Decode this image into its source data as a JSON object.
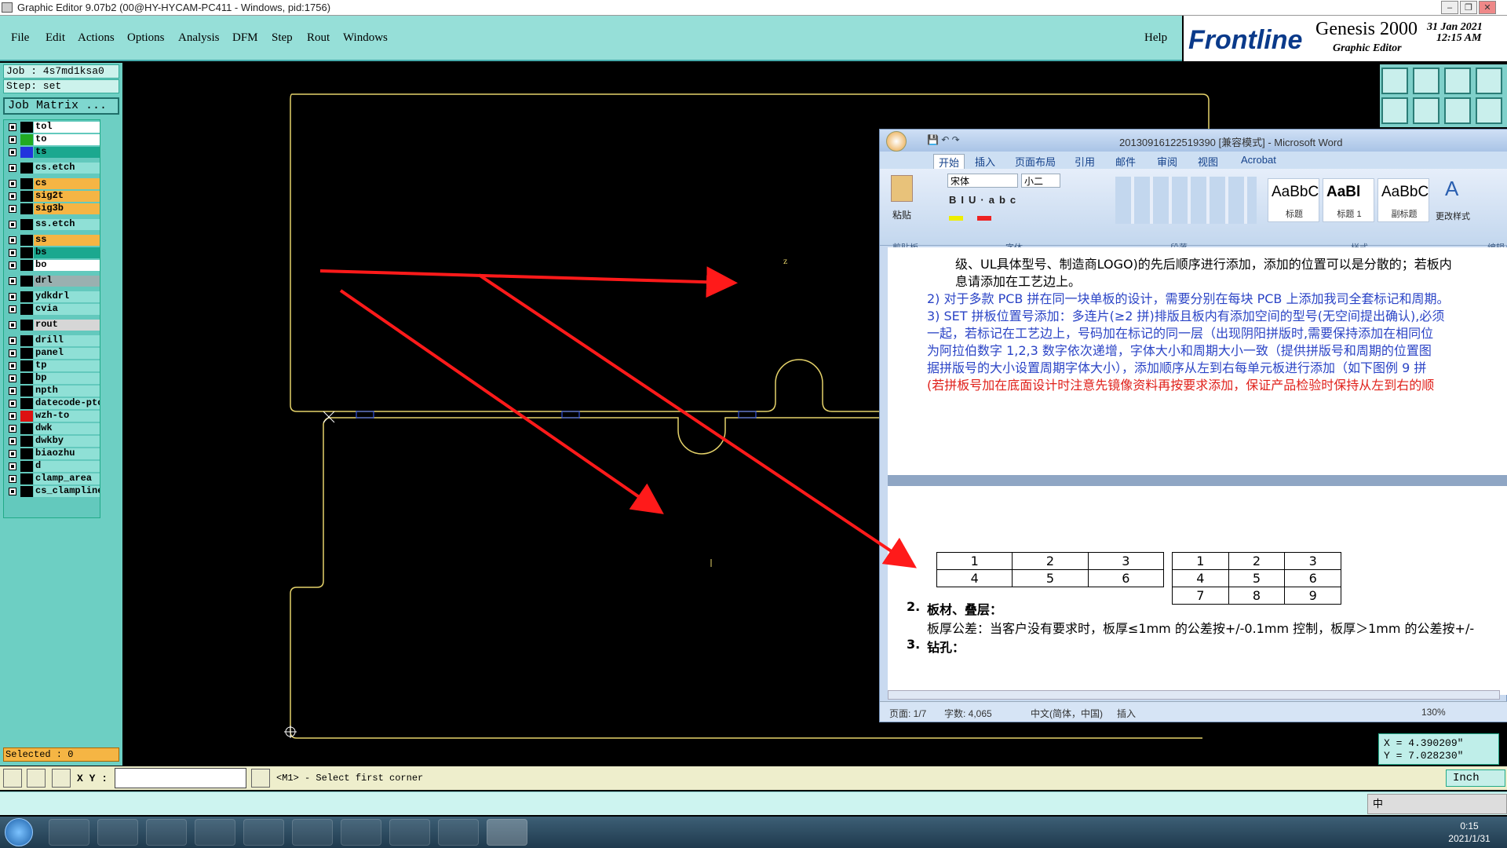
{
  "window": {
    "title": "Graphic Editor 9.07b2 (00@HY-HYCAM-PC411 - Windows, pid:1756)"
  },
  "menu": {
    "items": [
      "File",
      "Edit",
      "Actions",
      "Options",
      "Analysis",
      "DFM",
      "Step",
      "Rout",
      "Windows"
    ],
    "help": "Help"
  },
  "logo": {
    "brand": "Frontline",
    "product": "Genesis 2000",
    "sub": "Graphic Editor",
    "date": "31 Jan 2021",
    "time": "12:15 AM"
  },
  "job": {
    "job_label": "Job : 4s7md1ksa0",
    "step_label": "Step: set",
    "matrix_button": "Job Matrix ..."
  },
  "layers": [
    {
      "name": "tol",
      "color": "#000000",
      "bg": "#ffffff"
    },
    {
      "name": "to",
      "color": "#22aa22",
      "bg": "#ffffff"
    },
    {
      "name": "ts",
      "color": "#2233dd",
      "bg": "#1ba88f"
    },
    {
      "name": "cs.etch",
      "color": "#000000",
      "bg": "#8fe0d6"
    },
    {
      "name": "cs",
      "color": "#000000",
      "bg": "#f5b544"
    },
    {
      "name": "sig2t",
      "color": "#000000",
      "bg": "#f5b544"
    },
    {
      "name": "sig3b",
      "color": "#000000",
      "bg": "#f5b544"
    },
    {
      "name": "ss.etch",
      "color": "#000000",
      "bg": "#8fe0d6"
    },
    {
      "name": "ss",
      "color": "#000000",
      "bg": "#f5b544"
    },
    {
      "name": "bs",
      "color": "#000000",
      "bg": "#1ba88f"
    },
    {
      "name": "bo",
      "color": "#000000",
      "bg": "#ffffff"
    },
    {
      "name": "drl",
      "color": "#000000",
      "bg": "#9ab0b0"
    },
    {
      "name": "ydkdrl",
      "color": "#000000",
      "bg": "#8fe0d6"
    },
    {
      "name": "cvia",
      "color": "#000000",
      "bg": "#8fe0d6"
    },
    {
      "name": "rout",
      "color": "#000000",
      "bg": "#d6d6d6"
    },
    {
      "name": "drill",
      "color": "#000000",
      "bg": "#8fe0d6"
    },
    {
      "name": "panel",
      "color": "#000000",
      "bg": "#8fe0d6"
    },
    {
      "name": "tp",
      "color": "#000000",
      "bg": "#8fe0d6"
    },
    {
      "name": "bp",
      "color": "#000000",
      "bg": "#8fe0d6"
    },
    {
      "name": "npth",
      "color": "#000000",
      "bg": "#8fe0d6"
    },
    {
      "name": "datecode-pto",
      "color": "#000000",
      "bg": "#8fe0d6"
    },
    {
      "name": "wzh-to",
      "color": "#dd1111",
      "bg": "#8fe0d6"
    },
    {
      "name": "dwk",
      "color": "#000000",
      "bg": "#8fe0d6"
    },
    {
      "name": "dwkby",
      "color": "#000000",
      "bg": "#8fe0d6"
    },
    {
      "name": "biaozhu",
      "color": "#000000",
      "bg": "#8fe0d6"
    },
    {
      "name": "d",
      "color": "#000000",
      "bg": "#8fe0d6"
    },
    {
      "name": "clamp_area",
      "color": "#000000",
      "bg": "#8fe0d6"
    },
    {
      "name": "cs_clampline",
      "color": "#000000",
      "bg": "#8fe0d6"
    }
  ],
  "selected": "Selected : 0",
  "status": {
    "xy_label": "X Y :",
    "prompt": "<M1> - Select first corner",
    "x": "X = 4.390209\"",
    "y": "Y = 7.028230\"",
    "unit": "Inch",
    "ime": "中"
  },
  "word": {
    "title": "20130916122519390 [兼容模式] - Microsoft Word",
    "tabs": [
      "开始",
      "插入",
      "页面布局",
      "引用",
      "邮件",
      "审阅",
      "视图",
      "Acrobat"
    ],
    "font": "宋体",
    "size": "小二",
    "groups": [
      "剪贴板",
      "字体",
      "段落",
      "样式",
      "编辑"
    ],
    "paste": "粘贴",
    "change_styles": "更改样式",
    "styles": [
      {
        "preview": "AaBbC",
        "name": "标题"
      },
      {
        "preview": "AaBl",
        "name": "标题 1"
      },
      {
        "preview": "AaBbC",
        "name": "副标题"
      }
    ],
    "lines": [
      "级、UL具体型号、制造商LOGO)的先后顺序进行添加，添加的位置可以是分散的；若板内",
      "息请添加在工艺边上。",
      "2) 对于多款 PCB 拼在同一块单板的设计，需要分别在每块 PCB 上添加我司全套标记和周期。",
      "3) SET 拼板位置号添加：多连片(≥2 拼)排版且板内有添加空间的型号(无空间提出确认),必须",
      "一起，若标记在工艺边上，号码加在标记的同一层（出现阴阳拼版时,需要保持添加在相同位",
      "为阿拉伯数字 1,2,3 数字依次递增，字体大小和周期大小一致（提供拼版号和周期的位置图",
      "据拼版号的大小设置周期字体大小），添加顺序从左到右每单元板进行添加（如下图例 9 拼",
      "(若拼板号加在底面设计时注意先镜像资料再按要求添加，保证产品检验时保持从左到右的顺"
    ],
    "table1": [
      [
        "1",
        "2",
        "3"
      ],
      [
        "4",
        "5",
        "6"
      ]
    ],
    "table2": [
      [
        "1",
        "2",
        "3"
      ],
      [
        "4",
        "5",
        "6"
      ],
      [
        "7",
        "8",
        "9"
      ]
    ],
    "section2_num": "2.",
    "section2_title": "板材、叠层：",
    "section2_text": "板厚公差：当客户没有要求时，板厚≤1mm 的公差按+/-0.1mm 控制，板厚＞1mm 的公差按+/-",
    "section3_num": "3.",
    "section3_title": "钻孔：",
    "status_page": "页面: 1/7",
    "status_words": "字数: 4,065",
    "status_lang": "中文(简体，中国)",
    "status_mode": "插入",
    "zoom": "130%"
  },
  "taskbar": {
    "time": "0:15",
    "date": "2021/1/31"
  },
  "colors": {
    "teal": "#96dfd8",
    "outline": "#e6d36a",
    "arrow": "#ff1a1a"
  }
}
